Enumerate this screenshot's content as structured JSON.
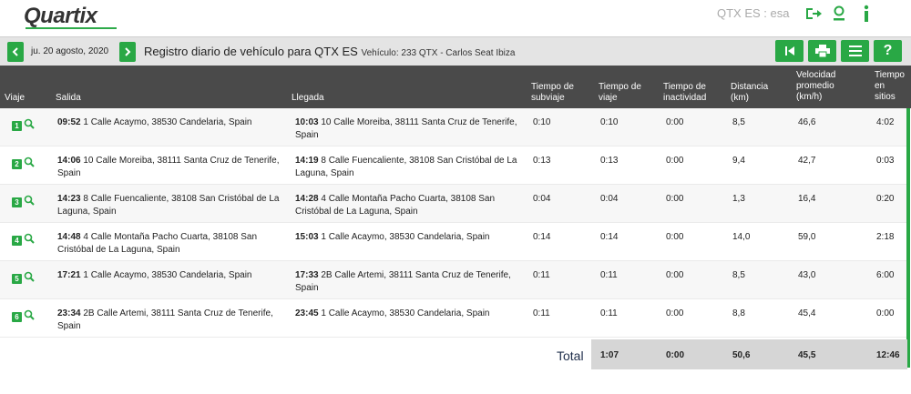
{
  "brand": {
    "logo_text": "Quartix",
    "accent_color": "#29a845"
  },
  "account": {
    "label": "QTX ES : esa"
  },
  "header_icons": [
    "logout-icon",
    "user-icon",
    "info-icon"
  ],
  "toolbar": {
    "date": "ju. 20 agosto, 2020",
    "title": "Registro diario de vehículo para QTX ES",
    "vehicle": "Vehículo: 233 QTX - Carlos Seat Ibiza",
    "buttons": [
      "first-page-icon",
      "print-icon",
      "menu-icon",
      "help-icon"
    ],
    "help_label": "?"
  },
  "columns": {
    "viaje": "Viaje",
    "salida": "Salida",
    "llegada": "Llegada",
    "subviaje": [
      "Tiempo de",
      "subviaje"
    ],
    "viaje_t": [
      "Tiempo de",
      "viaje"
    ],
    "inactividad": [
      "Tiempo de",
      "inactividad"
    ],
    "distancia": [
      "Distancia",
      "(km)"
    ],
    "velocidad": [
      "Velocidad",
      "promedio",
      "(km/h)"
    ],
    "sitios": [
      "Tiempo",
      "en",
      "sitios"
    ]
  },
  "trips": [
    {
      "n": "1",
      "dep_time": "09:52",
      "dep_addr": " 1 Calle Acaymo, 38530 Candelaria, Spain",
      "arr_time": "10:03",
      "arr_addr": " 10 Calle Moreiba, 38111 Santa Cruz de Tenerife, Spain",
      "subviaje": "0:10",
      "viaje": "0:10",
      "inact": "0:00",
      "dist": "8,5",
      "vel": "46,6",
      "sitios": "4:02"
    },
    {
      "n": "2",
      "dep_time": "14:06",
      "dep_addr": " 10 Calle Moreiba, 38111 Santa Cruz de Tenerife, Spain",
      "arr_time": "14:19",
      "arr_addr": " 8 Calle Fuencaliente, 38108 San Cristóbal de La Laguna, Spain",
      "subviaje": "0:13",
      "viaje": "0:13",
      "inact": "0:00",
      "dist": "9,4",
      "vel": "42,7",
      "sitios": "0:03"
    },
    {
      "n": "3",
      "dep_time": "14:23",
      "dep_addr": " 8 Calle Fuencaliente, 38108 San Cristóbal de La Laguna, Spain",
      "arr_time": "14:28",
      "arr_addr": " 4 Calle Montaña Pacho Cuarta, 38108 San Cristóbal de La Laguna, Spain",
      "subviaje": "0:04",
      "viaje": "0:04",
      "inact": "0:00",
      "dist": "1,3",
      "vel": "16,4",
      "sitios": "0:20"
    },
    {
      "n": "4",
      "dep_time": "14:48",
      "dep_addr": " 4 Calle Montaña Pacho Cuarta, 38108 San Cristóbal de La Laguna, Spain",
      "arr_time": "15:03",
      "arr_addr": " 1 Calle Acaymo, 38530 Candelaria, Spain",
      "subviaje": "0:14",
      "viaje": "0:14",
      "inact": "0:00",
      "dist": "14,0",
      "vel": "59,0",
      "sitios": "2:18"
    },
    {
      "n": "5",
      "dep_time": "17:21",
      "dep_addr": " 1 Calle Acaymo, 38530 Candelaria, Spain",
      "arr_time": "17:33",
      "arr_addr": " 2B Calle Artemi, 38111 Santa Cruz de Tenerife, Spain",
      "subviaje": "0:11",
      "viaje": "0:11",
      "inact": "0:00",
      "dist": "8,5",
      "vel": "43,0",
      "sitios": "6:00"
    },
    {
      "n": "6",
      "dep_time": "23:34",
      "dep_addr": " 2B Calle Artemi, 38111 Santa Cruz de Tenerife, Spain",
      "arr_time": "23:45",
      "arr_addr": " 1 Calle Acaymo, 38530 Candelaria, Spain",
      "subviaje": "0:11",
      "viaje": "0:11",
      "inact": "0:00",
      "dist": "8,8",
      "vel": "45,4",
      "sitios": "0:00"
    }
  ],
  "totals": {
    "label": "Total",
    "viaje": "1:07",
    "inact": "0:00",
    "dist": "50,6",
    "vel": "45,5",
    "sitios": "12:46"
  }
}
